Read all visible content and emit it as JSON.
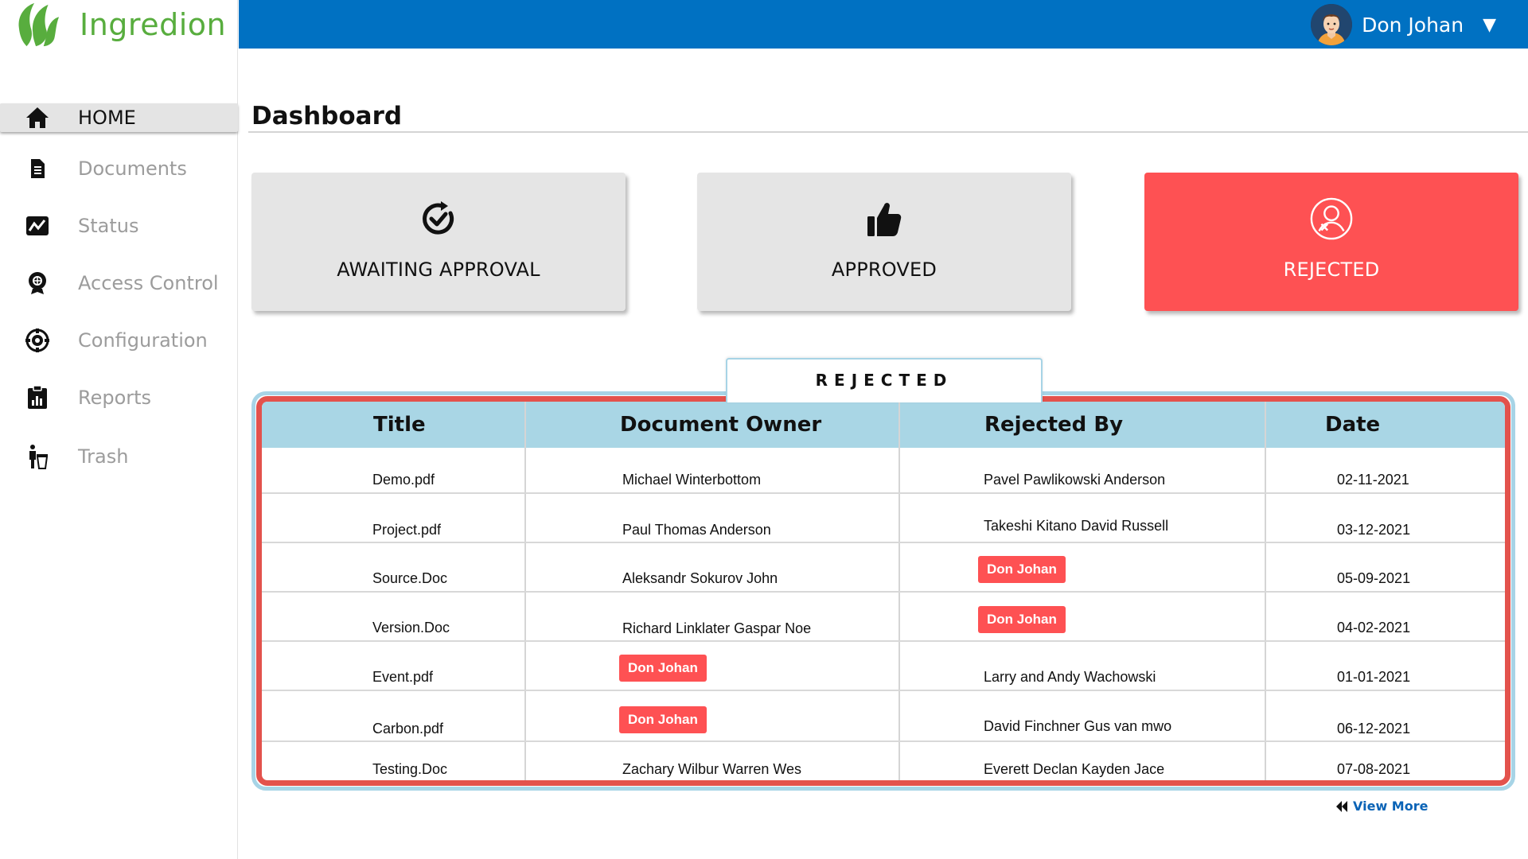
{
  "app": {
    "name": "Ingredion"
  },
  "header": {
    "user_name": "Don Johan"
  },
  "sidebar": {
    "items": [
      {
        "label": "HOME",
        "icon": "home-icon"
      },
      {
        "label": "Documents",
        "icon": "document-icon"
      },
      {
        "label": "Status",
        "icon": "status-icon"
      },
      {
        "label": "Access Control",
        "icon": "access-control-icon"
      },
      {
        "label": "Configuration",
        "icon": "configuration-icon"
      },
      {
        "label": "Reports",
        "icon": "reports-icon"
      },
      {
        "label": "Trash",
        "icon": "trash-icon"
      }
    ]
  },
  "main": {
    "title": "Dashboard",
    "cards": [
      {
        "label": "AWAITING APPROVAL",
        "icon": "awaiting-icon"
      },
      {
        "label": "APPROVED",
        "icon": "thumbs-up-icon"
      },
      {
        "label": "REJECTED",
        "icon": "rejected-user-icon"
      }
    ],
    "table": {
      "tab_label": "REJECTED",
      "columns": [
        "Title",
        "Document Owner",
        "Rejected By",
        "Date"
      ],
      "rows": [
        {
          "title": "Demo.pdf",
          "owner": "Michael Winterbottom",
          "rejected_by": "Pavel Pawlikowski Anderson",
          "date": "02-11-2021"
        },
        {
          "title": "Project.pdf",
          "owner": "Paul Thomas Anderson",
          "rejected_by": "Takeshi Kitano David Russell",
          "date": "03-12-2021"
        },
        {
          "title": "Source.Doc",
          "owner": "Aleksandr Sokurov John",
          "rejected_by": "Don Johan",
          "date": "05-09-2021"
        },
        {
          "title": "Version.Doc",
          "owner": "Richard Linklater Gaspar Noe",
          "rejected_by": "Don Johan",
          "date": "04-02-2021"
        },
        {
          "title": "Event.pdf",
          "owner": "Don Johan",
          "rejected_by": "Larry and Andy Wachowski",
          "date": "01-01-2021"
        },
        {
          "title": "Carbon.pdf",
          "owner": "Don Johan",
          "rejected_by": "David Finchner Gus van mwo",
          "date": "06-12-2021"
        },
        {
          "title": "Testing.Doc",
          "owner": "Zachary Wilbur Warren Wes",
          "rejected_by": "Everett Declan Kayden Jace",
          "date": "07-08-2021"
        }
      ]
    },
    "view_more": "View More"
  },
  "colors": {
    "brand_green": "#58ad3e",
    "header_blue": "#0071c2",
    "rejected_red": "#fe5153",
    "table_header": "#a9d6e5"
  }
}
